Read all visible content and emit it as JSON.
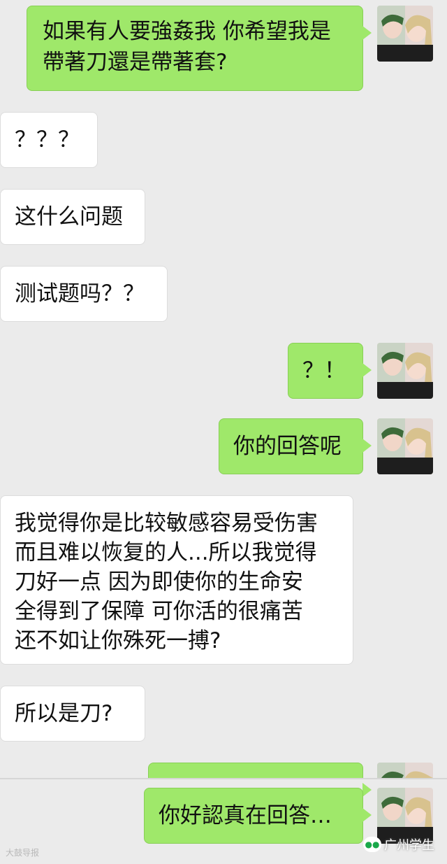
{
  "messages": [
    {
      "side": "right",
      "text": "如果有人要強姦我 你希望我是\n帶著刀還是帶著套?"
    },
    {
      "side": "left",
      "text": "？？？"
    },
    {
      "side": "left",
      "text": "这什么问题"
    },
    {
      "side": "left",
      "text": "测试题吗？？"
    },
    {
      "side": "right",
      "text": "？！"
    },
    {
      "side": "right",
      "text": "你的回答呢"
    },
    {
      "side": "left",
      "text": "我觉得你是比较敏感容易受伤害\n而且难以恢复的人...所以我觉得\n刀好一点 因为即使你的生命安\n全得到了保障 可你活的很痛苦\n还不如让你殊死一搏?"
    },
    {
      "side": "left",
      "text": "所以是刀?"
    },
    {
      "side": "right",
      "text": "你好認真在回答…"
    }
  ],
  "watermarks": {
    "left": "大鼓导报",
    "right": "广州学生"
  },
  "icons": {
    "avatar": "couple-avatar-icon",
    "watermark": "wechat-account-icon"
  },
  "colors": {
    "background": "#ebebeb",
    "bubble_right": "#9fe86a",
    "bubble_left": "#ffffff"
  }
}
